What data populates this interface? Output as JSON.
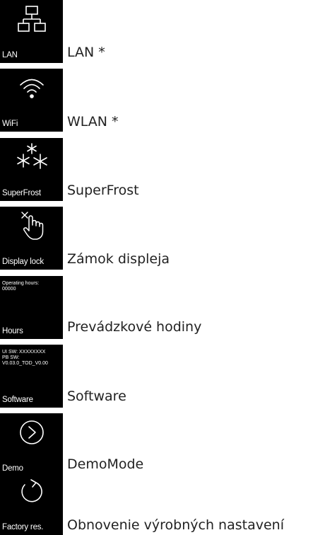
{
  "menu": {
    "items": [
      {
        "tile_label": "LAN",
        "label": "LAN *",
        "icon": "lan-icon"
      },
      {
        "tile_label": "WiFi",
        "label": "WLAN *",
        "icon": "wifi-icon"
      },
      {
        "tile_label": "SuperFrost",
        "label": "SuperFrost",
        "icon": "snowflakes-icon"
      },
      {
        "tile_label": "Display lock",
        "label": "Zámok displeja",
        "icon": "touch-hand-icon"
      },
      {
        "tile_label": "Hours",
        "label": "Prevádzkové hodiny",
        "info_lines": [
          "Operating hours:",
          "00000"
        ]
      },
      {
        "tile_label": "Software",
        "label": "Software",
        "info_lines": [
          "UI SW: XXXXXXXX",
          "PB SW:",
          "V0.03.0_TOD_V0.00"
        ]
      },
      {
        "tile_label": "Demo",
        "label": "DemoMode",
        "icon": "play-circle-icon"
      },
      {
        "tile_label": "Factory res.",
        "label": "Obnovenie výrobných nastavení",
        "icon": "reset-arrow-icon"
      }
    ]
  },
  "colors": {
    "tile_background": "#000000",
    "tile_foreground": "#ffffff",
    "label_text": "#222222"
  }
}
